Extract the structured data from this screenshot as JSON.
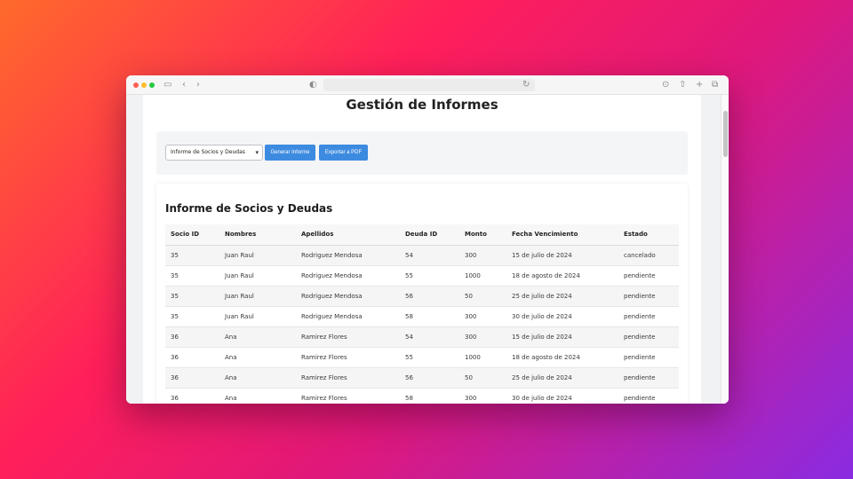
{
  "browser": {
    "icons": [
      "sidebar-icon",
      "back-icon",
      "forward-icon",
      "shield-icon",
      "reload-icon",
      "download-icon",
      "share-icon",
      "new-tab-icon",
      "tabs-icon"
    ]
  },
  "page": {
    "title": "Gestión de Informes"
  },
  "controls": {
    "report_select": "Informe de Socios y Deudas",
    "generate_label": "Generar Informe",
    "export_label": "Exportar a PDF"
  },
  "report": {
    "title": "Informe de Socios y Deudas",
    "columns": [
      "Socio ID",
      "Nombres",
      "Apellidos",
      "Deuda ID",
      "Monto",
      "Fecha Vencimiento",
      "Estado"
    ],
    "rows": [
      [
        "35",
        "Juan Raul",
        "Rodriguez Mendosa",
        "54",
        "300",
        "15 de julio de 2024",
        "cancelado"
      ],
      [
        "35",
        "Juan Raul",
        "Rodriguez Mendosa",
        "55",
        "1000",
        "18 de agosto de 2024",
        "pendiente"
      ],
      [
        "35",
        "Juan Raul",
        "Rodriguez Mendosa",
        "56",
        "50",
        "25 de julio de 2024",
        "pendiente"
      ],
      [
        "35",
        "Juan Raul",
        "Rodriguez Mendosa",
        "58",
        "300",
        "30 de julio de 2024",
        "pendiente"
      ],
      [
        "36",
        "Ana",
        "Ramirez Flores",
        "54",
        "300",
        "15 de julio de 2024",
        "pendiente"
      ],
      [
        "36",
        "Ana",
        "Ramirez Flores",
        "55",
        "1000",
        "18 de agosto de 2024",
        "pendiente"
      ],
      [
        "36",
        "Ana",
        "Ramirez Flores",
        "56",
        "50",
        "25 de julio de 2024",
        "pendiente"
      ],
      [
        "36",
        "Ana",
        "Ramirez Flores",
        "58",
        "300",
        "30 de julio de 2024",
        "pendiente"
      ]
    ]
  },
  "colors": {
    "accent": "#3d8be0",
    "close": "#ff5f57",
    "minimize": "#febc2e",
    "maximize": "#28c840"
  }
}
